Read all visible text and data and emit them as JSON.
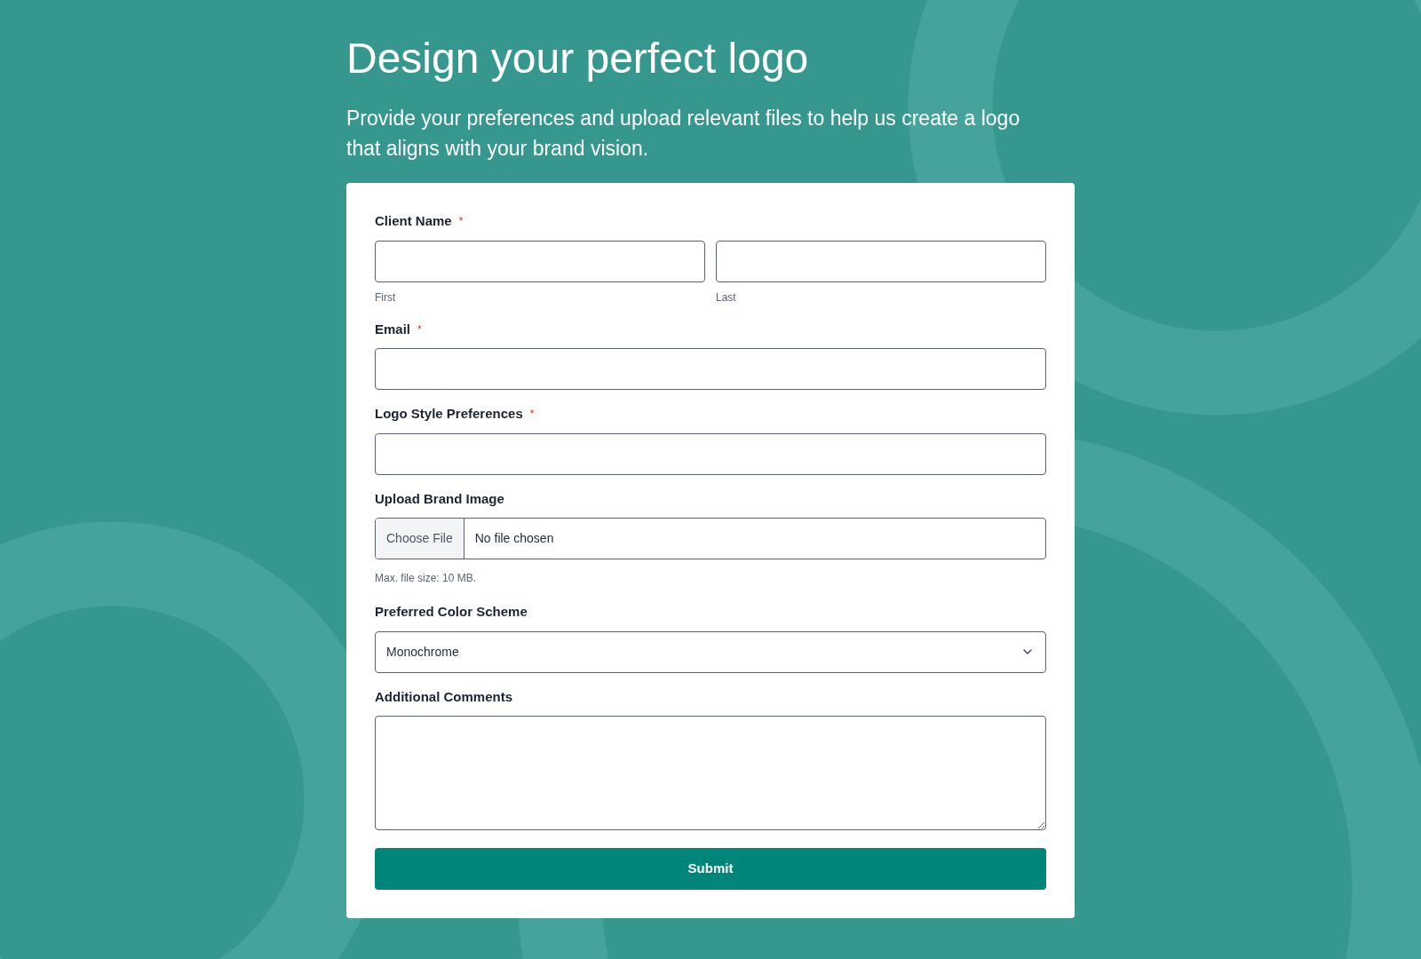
{
  "title": "Design your perfect logo",
  "subtitle": "Provide your preferences and upload relevant files to help us create a logo that aligns with your brand vision.",
  "fields": [
    {
      "kind": "name",
      "label": "Client Name",
      "asterisk": "*",
      "sublabels": [
        "First",
        "Last"
      ]
    },
    {
      "kind": "text",
      "label": "Email",
      "asterisk": "*"
    },
    {
      "kind": "text",
      "label": "Logo Style Preferences",
      "asterisk": "*"
    },
    {
      "kind": "file",
      "label": "Upload Brand Image",
      "button": "Choose File",
      "status": "No file chosen",
      "hint": "Max. file size: 10 MB."
    },
    {
      "kind": "select",
      "label": "Preferred Color Scheme",
      "value": "Monochrome"
    },
    {
      "kind": "textarea",
      "label": "Additional Comments"
    }
  ],
  "submit": "Submit"
}
